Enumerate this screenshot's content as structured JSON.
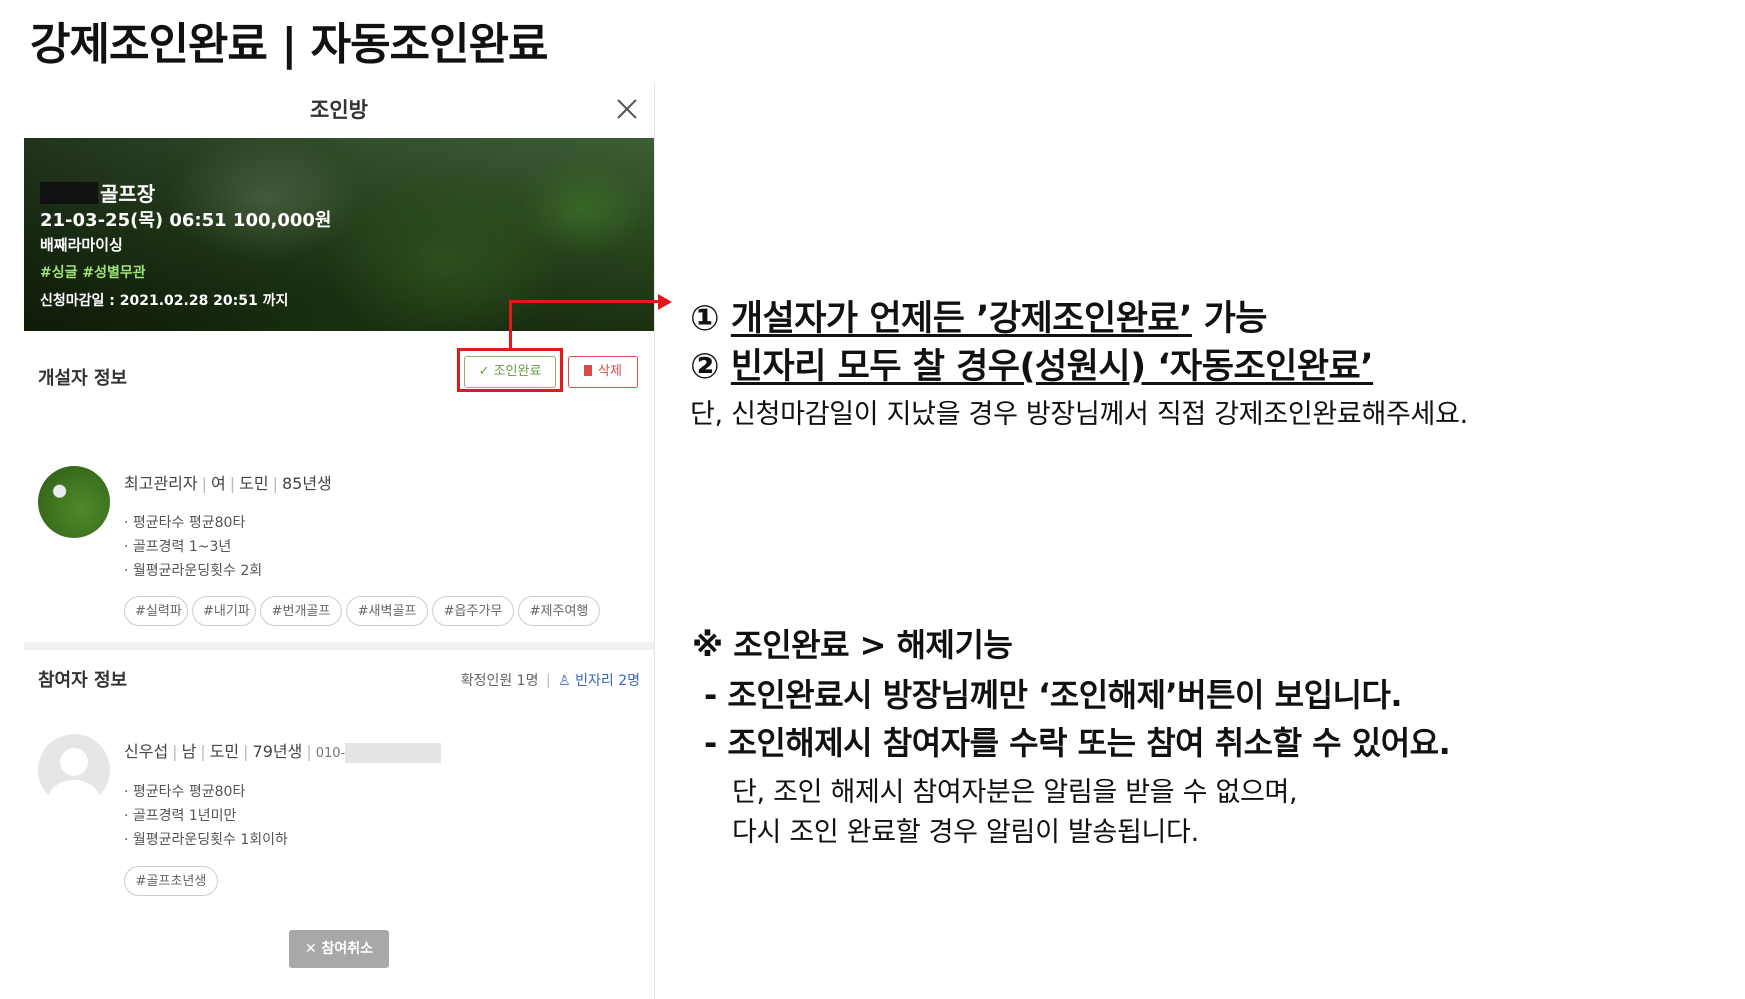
{
  "page_title": "강제조인완료 | 자동조인완료",
  "modal": {
    "title": "조인방",
    "hero": {
      "course": "골프장",
      "datetime_price": "21-03-25(목) 06:51 100,000원",
      "subtitle": "배째라마이싱",
      "tags": "#싱글 #성별무관",
      "deadline": "신청마감일 : 2021.02.28 20:51 까지"
    },
    "host_section": {
      "title": "개설자 정보",
      "complete_button": "✓ 조인완료",
      "delete_button": "삭제",
      "name": "최고관리자",
      "gender": "여",
      "region": "도민",
      "birth": "85년생",
      "stats": [
        "· 평균타수 평균80타",
        "· 골프경력 1~3년",
        "· 월평균라운딩횟수 2회"
      ],
      "tags": [
        "#실력파",
        "#내기파",
        "#번개골프",
        "#새벽골프",
        "#읍주가무",
        "#제주여행"
      ]
    },
    "guest_section": {
      "title": "참여자 정보",
      "confirmed": "확정인원 1명",
      "vacancy": "빈자리 2명",
      "name": "신우섭",
      "gender": "남",
      "region": "도민",
      "birth": "79년생",
      "phone": "010-",
      "stats": [
        "· 평균타수 평균80타",
        "· 골프경력 1년미만",
        "· 월평균라운딩횟수 1회이하"
      ],
      "tags": [
        "#골프초년생"
      ],
      "cancel_button": "✕ 참여취소"
    }
  },
  "annotations": {
    "line1_num": "①",
    "line1_ul": "개설자가 언제든 ’강제조인완료’",
    "line1_tail": " 가능",
    "line2_num": "②",
    "line2_ul": "빈자리 모두 찰 경우(성원시) ‘자동조인완료’",
    "line3": "단, 신청마감일이 지났을 경우 방장님께서 직접 강제조인완료해주세요.",
    "note_title": "※ 조인완료 > 해제기능",
    "note1": "- 조인완료시 방장님께만 ‘조인해제’버튼이 보입니다.",
    "note2": "- 조인해제시 참여자를 수락 또는 참여 취소할 수 있어요.",
    "note3": "단, 조인 해제시 참여자분은 알림을 받을 수 없으며,",
    "note4": "다시 조인 완료할 경우 알림이 발송됩니다."
  },
  "colors": {
    "highlight": "#e0191b",
    "complete_button": "#6a9a45",
    "delete_button": "#d94a4a",
    "vacancy": "#3a65c4"
  }
}
